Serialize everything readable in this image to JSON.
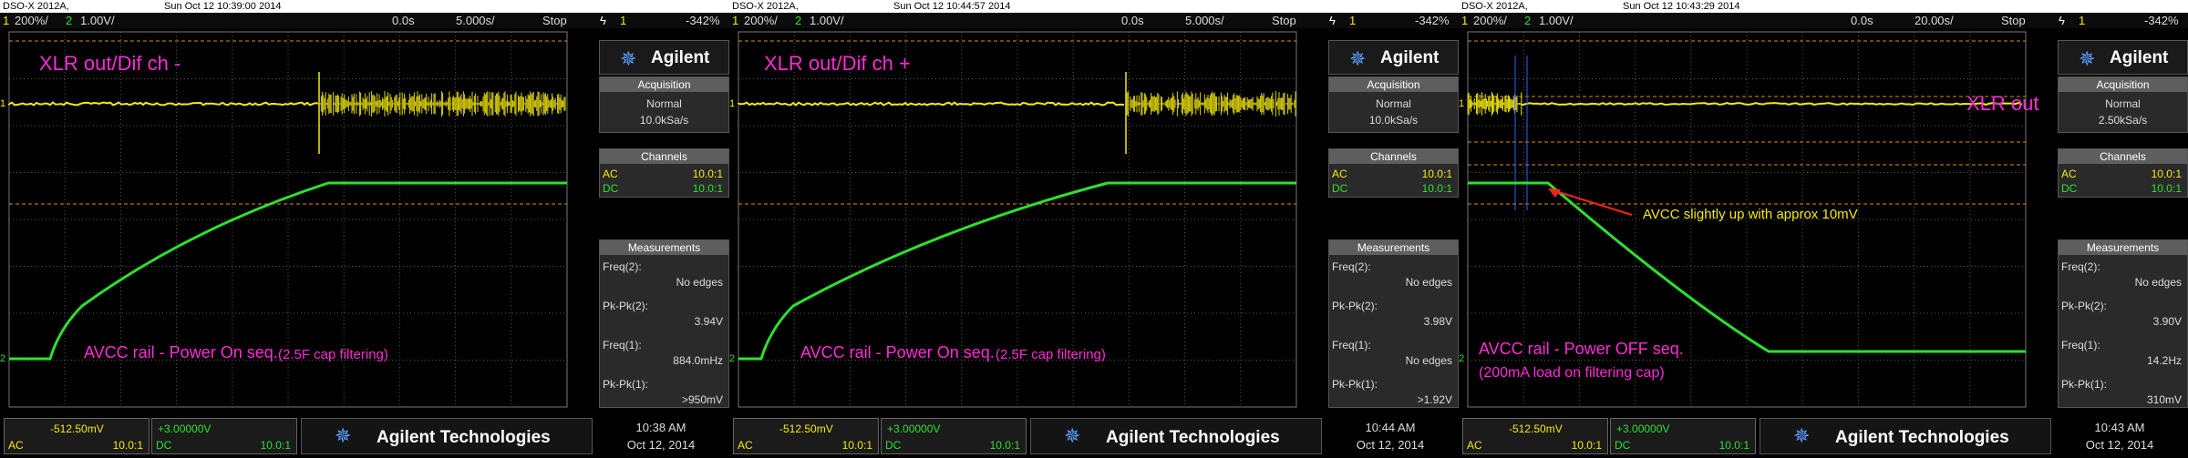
{
  "panels": [
    {
      "model": "DSO-X 2012A,",
      "datetime": "Sun Oct 12 10:39:00 2014",
      "status": {
        "ch1_num": "1",
        "ch1_scale": "200%/",
        "ch2_num": "2",
        "ch2_scale": "1.00V/",
        "time_pos": "0.0s",
        "time_scale": "5.000s/",
        "run_state": "Stop",
        "trig_ch": "1",
        "trig_level": "-342%"
      },
      "labels": {
        "top": "XLR out/Dif ch -",
        "bottom": "AVCC rail - Power On seq.",
        "bottom_small": "(2.5F cap filtering)"
      },
      "sidebar": {
        "brand": "Agilent",
        "acquisition_title": "Acquisition",
        "acq_mode": "Normal",
        "acq_rate": "10.0kSa/s",
        "channels_title": "Channels",
        "ch1_coupling": "AC",
        "ch1_probe": "10.0:1",
        "ch2_coupling": "DC",
        "ch2_probe": "10.0:1",
        "measurements_title": "Measurements",
        "m1_label": "Freq(2):",
        "m1_value": "No edges",
        "m2_label": "Pk-Pk(2):",
        "m2_value": "3.94V",
        "m3_label": "Freq(1):",
        "m3_value": "884.0mHz",
        "m4_label": "Pk-Pk(1):",
        "m4_value": ">950mV"
      },
      "bottom": {
        "ch1_offset": "-512.50mV",
        "ch1_coupling": "AC",
        "ch1_probe": "10.0:1",
        "ch2_offset": "+3.00000V",
        "ch2_coupling": "DC",
        "ch2_probe": "10.0:1",
        "brand": "Agilent Technologies",
        "time": "10:38 AM",
        "date": "Oct 12, 2014"
      }
    },
    {
      "model": "DSO-X 2012A,",
      "datetime": "Sun Oct 12 10:44:57 2014",
      "status": {
        "ch1_num": "1",
        "ch1_scale": "200%/",
        "ch2_num": "2",
        "ch2_scale": "1.00V/",
        "time_pos": "0.0s",
        "time_scale": "5.000s/",
        "run_state": "Stop",
        "trig_ch": "1",
        "trig_level": "-342%"
      },
      "labels": {
        "top": "XLR out/Dif ch +",
        "bottom": "AVCC rail - Power On seq.",
        "bottom_small": "(2.5F cap filtering)"
      },
      "sidebar": {
        "brand": "Agilent",
        "acquisition_title": "Acquisition",
        "acq_mode": "Normal",
        "acq_rate": "10.0kSa/s",
        "channels_title": "Channels",
        "ch1_coupling": "AC",
        "ch1_probe": "10.0:1",
        "ch2_coupling": "DC",
        "ch2_probe": "10.0:1",
        "measurements_title": "Measurements",
        "m1_label": "Freq(2):",
        "m1_value": "No edges",
        "m2_label": "Pk-Pk(2):",
        "m2_value": "3.98V",
        "m3_label": "Freq(1):",
        "m3_value": "No edges",
        "m4_label": "Pk-Pk(1):",
        "m4_value": ">1.92V"
      },
      "bottom": {
        "ch1_offset": "-512.50mV",
        "ch1_coupling": "AC",
        "ch1_probe": "10.0:1",
        "ch2_offset": "+3.00000V",
        "ch2_coupling": "DC",
        "ch2_probe": "10.0:1",
        "brand": "Agilent Technologies",
        "time": "10:44 AM",
        "date": "Oct 12, 2014"
      }
    },
    {
      "model": "DSO-X 2012A,",
      "datetime": "Sun Oct 12 10:43:29 2014",
      "status": {
        "ch1_num": "1",
        "ch1_scale": "200%/",
        "ch2_num": "2",
        "ch2_scale": "1.00V/",
        "time_pos": "0.0s",
        "time_scale": "20.00s/",
        "run_state": "Stop",
        "trig_ch": "1",
        "trig_level": "-342%"
      },
      "labels": {
        "top": "XLR out",
        "bottom": "AVCC rail - Power OFF seq.",
        "bottom_small": "(200mA load on filtering cap)",
        "annotation": "AVCC slightly up with approx 10mV"
      },
      "sidebar": {
        "brand": "Agilent",
        "acquisition_title": "Acquisition",
        "acq_mode": "Normal",
        "acq_rate": "2.50kSa/s",
        "channels_title": "Channels",
        "ch1_coupling": "AC",
        "ch1_probe": "10.0:1",
        "ch2_coupling": "DC",
        "ch2_probe": "10.0:1",
        "measurements_title": "Measurements",
        "m1_label": "Freq(2):",
        "m1_value": "No edges",
        "m2_label": "Pk-Pk(2):",
        "m2_value": "3.90V",
        "m3_label": "Freq(1):",
        "m3_value": "14.2Hz",
        "m4_label": "Pk-Pk(1):",
        "m4_value": "310mV"
      },
      "bottom": {
        "ch1_offset": "-512.50mV",
        "ch1_coupling": "AC",
        "ch1_probe": "10.0:1",
        "ch2_offset": "+3.00000V",
        "ch2_coupling": "DC",
        "ch2_probe": "10.0:1",
        "brand": "Agilent Technologies",
        "time": "10:43 AM",
        "date": "Oct 12, 2014"
      }
    }
  ],
  "colors": {
    "ch1": "#f5ea10",
    "ch2": "#2ee02e",
    "label": "#ff2bd6",
    "grid": "#5a5a5a",
    "cursor": "#e08a1a",
    "annotation_arrow": "#ff2020",
    "annotation_text": "#f5ea10"
  }
}
